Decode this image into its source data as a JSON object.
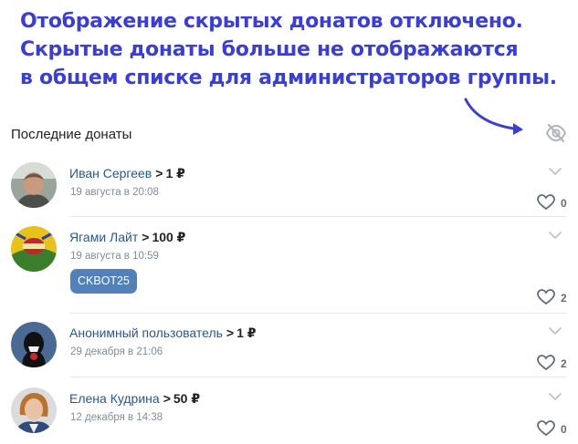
{
  "banner": {
    "line1": "Отображение скрытых донатов отключено.",
    "line2": "Скрытые донаты больше не отображаются",
    "line3": "в общем списке для администраторов группы."
  },
  "section": {
    "title": "Последние донаты"
  },
  "donations": [
    {
      "name": "Иван Сергеев",
      "separator": ">",
      "amount": "1 ₽",
      "date": "19 августа в 20:08",
      "likes": "0"
    },
    {
      "name": "Ягами Лайт",
      "separator": ">",
      "amount": "100 ₽",
      "date": "19 августа в 10:59",
      "tag": "CKBOT25",
      "likes": "2"
    },
    {
      "name": "Анонимный пользователь",
      "separator": ">",
      "amount": "1 ₽",
      "date": "29 декабря в 21:06",
      "likes": "2"
    },
    {
      "name": "Елена Кудрина",
      "separator": ">",
      "amount": "50 ₽",
      "date": "12 декабря в 14:38",
      "likes": "0"
    }
  ],
  "colors": {
    "banner_text": "#3b3fd0",
    "link": "#2a5885",
    "tag_bg": "#5181b8",
    "muted": "#818c99"
  },
  "icons": {
    "hidden": "eye-off-icon",
    "expand": "chevron-down-icon",
    "like": "heart-icon",
    "pointer": "curved-arrow-icon"
  }
}
